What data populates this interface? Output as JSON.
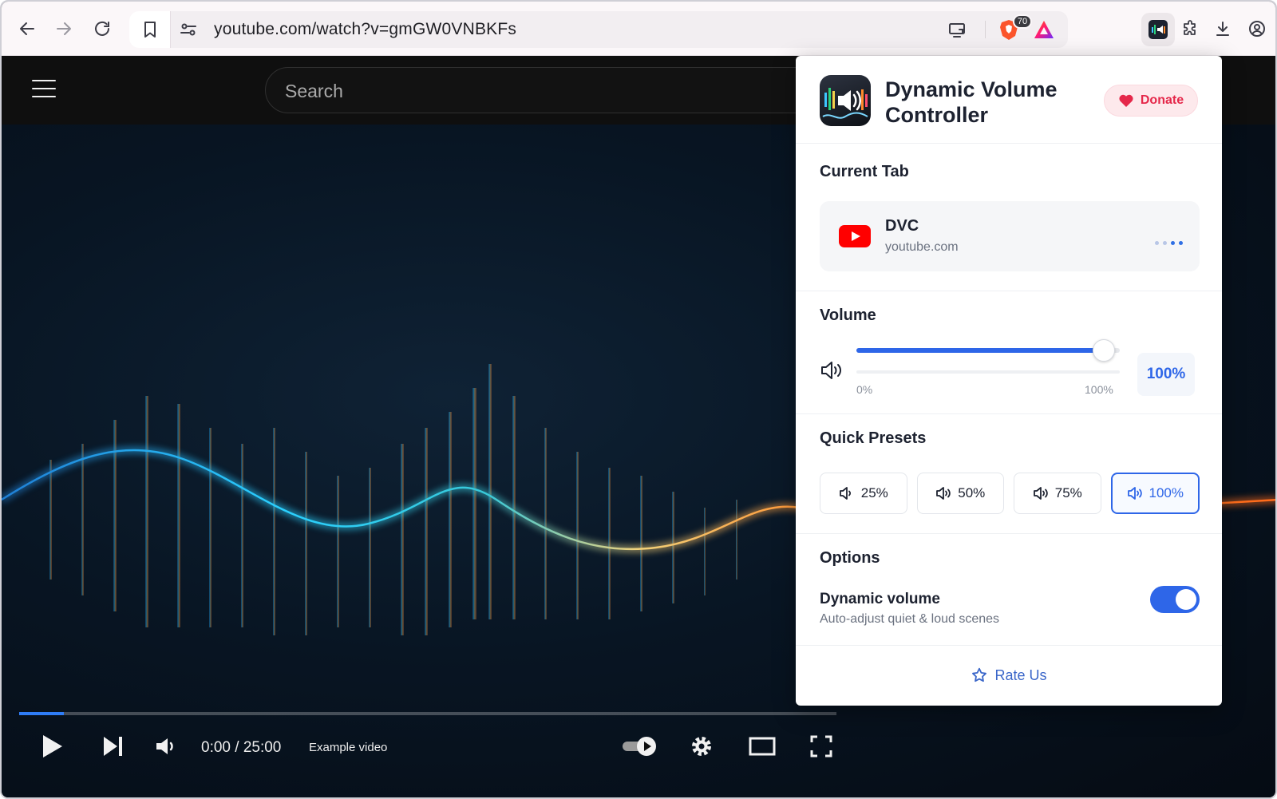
{
  "browser": {
    "url": "youtube.com/watch?v=gmGW0VNBKFs",
    "brave_badge": "70"
  },
  "youtube": {
    "search_placeholder": "Search",
    "player": {
      "time": "0:00 / 25:00",
      "video_title": "Example video",
      "progress": 0.055
    }
  },
  "popup": {
    "title": "Dynamic Volume Controller",
    "donate_label": "Donate",
    "current_tab": {
      "section_title": "Current Tab",
      "tab_name": "DVC",
      "tab_domain": "youtube.com"
    },
    "volume": {
      "section_title": "Volume",
      "value": 100,
      "value_label": "100%",
      "min_label": "0%",
      "max_label": "100%"
    },
    "presets": {
      "section_title": "Quick Presets",
      "items": [
        {
          "label": "25%",
          "active": false
        },
        {
          "label": "50%",
          "active": false
        },
        {
          "label": "75%",
          "active": false
        },
        {
          "label": "100%",
          "active": true
        }
      ]
    },
    "options": {
      "section_title": "Options",
      "dynamic_volume": {
        "title": "Dynamic volume",
        "description": "Auto-adjust quiet & loud scenes",
        "enabled": true
      }
    },
    "rate_label": "Rate Us"
  },
  "colors": {
    "accent": "#2e66e8",
    "donate": "#e5284a",
    "youtube_red": "#ff0000"
  },
  "icons": [
    "back-arrow-icon",
    "forward-arrow-icon",
    "reload-icon",
    "bookmark-icon",
    "site-settings-icon",
    "cast-icon",
    "brave-shield-icon",
    "brave-rewards-icon",
    "extension-icon",
    "puzzle-icon",
    "download-icon",
    "profile-icon",
    "heart-icon",
    "youtube-icon",
    "speaker-icon",
    "star-icon"
  ]
}
